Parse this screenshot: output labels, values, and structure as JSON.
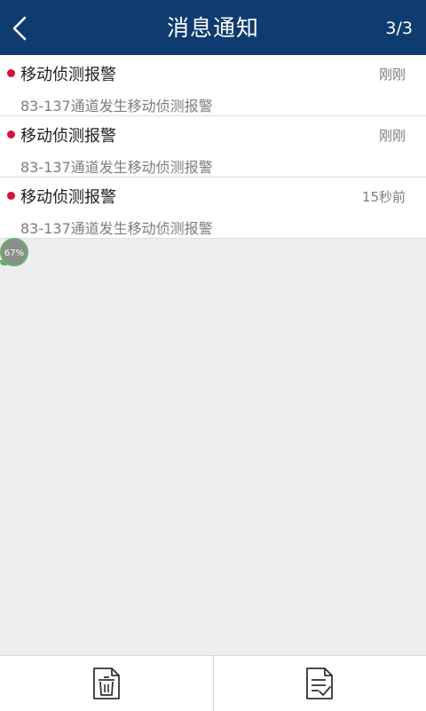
{
  "header": {
    "title": "消息通知",
    "page_counter": "3/3",
    "back_icon": "chevron-left-icon",
    "background_color": "#0f3c70"
  },
  "notifications": [
    {
      "title": "移动侦测报警",
      "time": "刚刚",
      "description": "83-137通道发生移动侦测报警",
      "unread_dot_color": "#d5103c"
    },
    {
      "title": "移动侦测报警",
      "time": "刚刚",
      "description": "83-137通道发生移动侦测报警",
      "unread_dot_color": "#d5103c"
    },
    {
      "title": "移动侦测报警",
      "time": "15秒前",
      "description": "83-137通道发生移动侦测报警",
      "unread_dot_color": "#d5103c"
    }
  ],
  "progress_badge": {
    "label": "67%",
    "value": 0.67
  },
  "footer": {
    "delete_icon": "trash-icon",
    "mark_read_icon": "document-check-icon"
  }
}
